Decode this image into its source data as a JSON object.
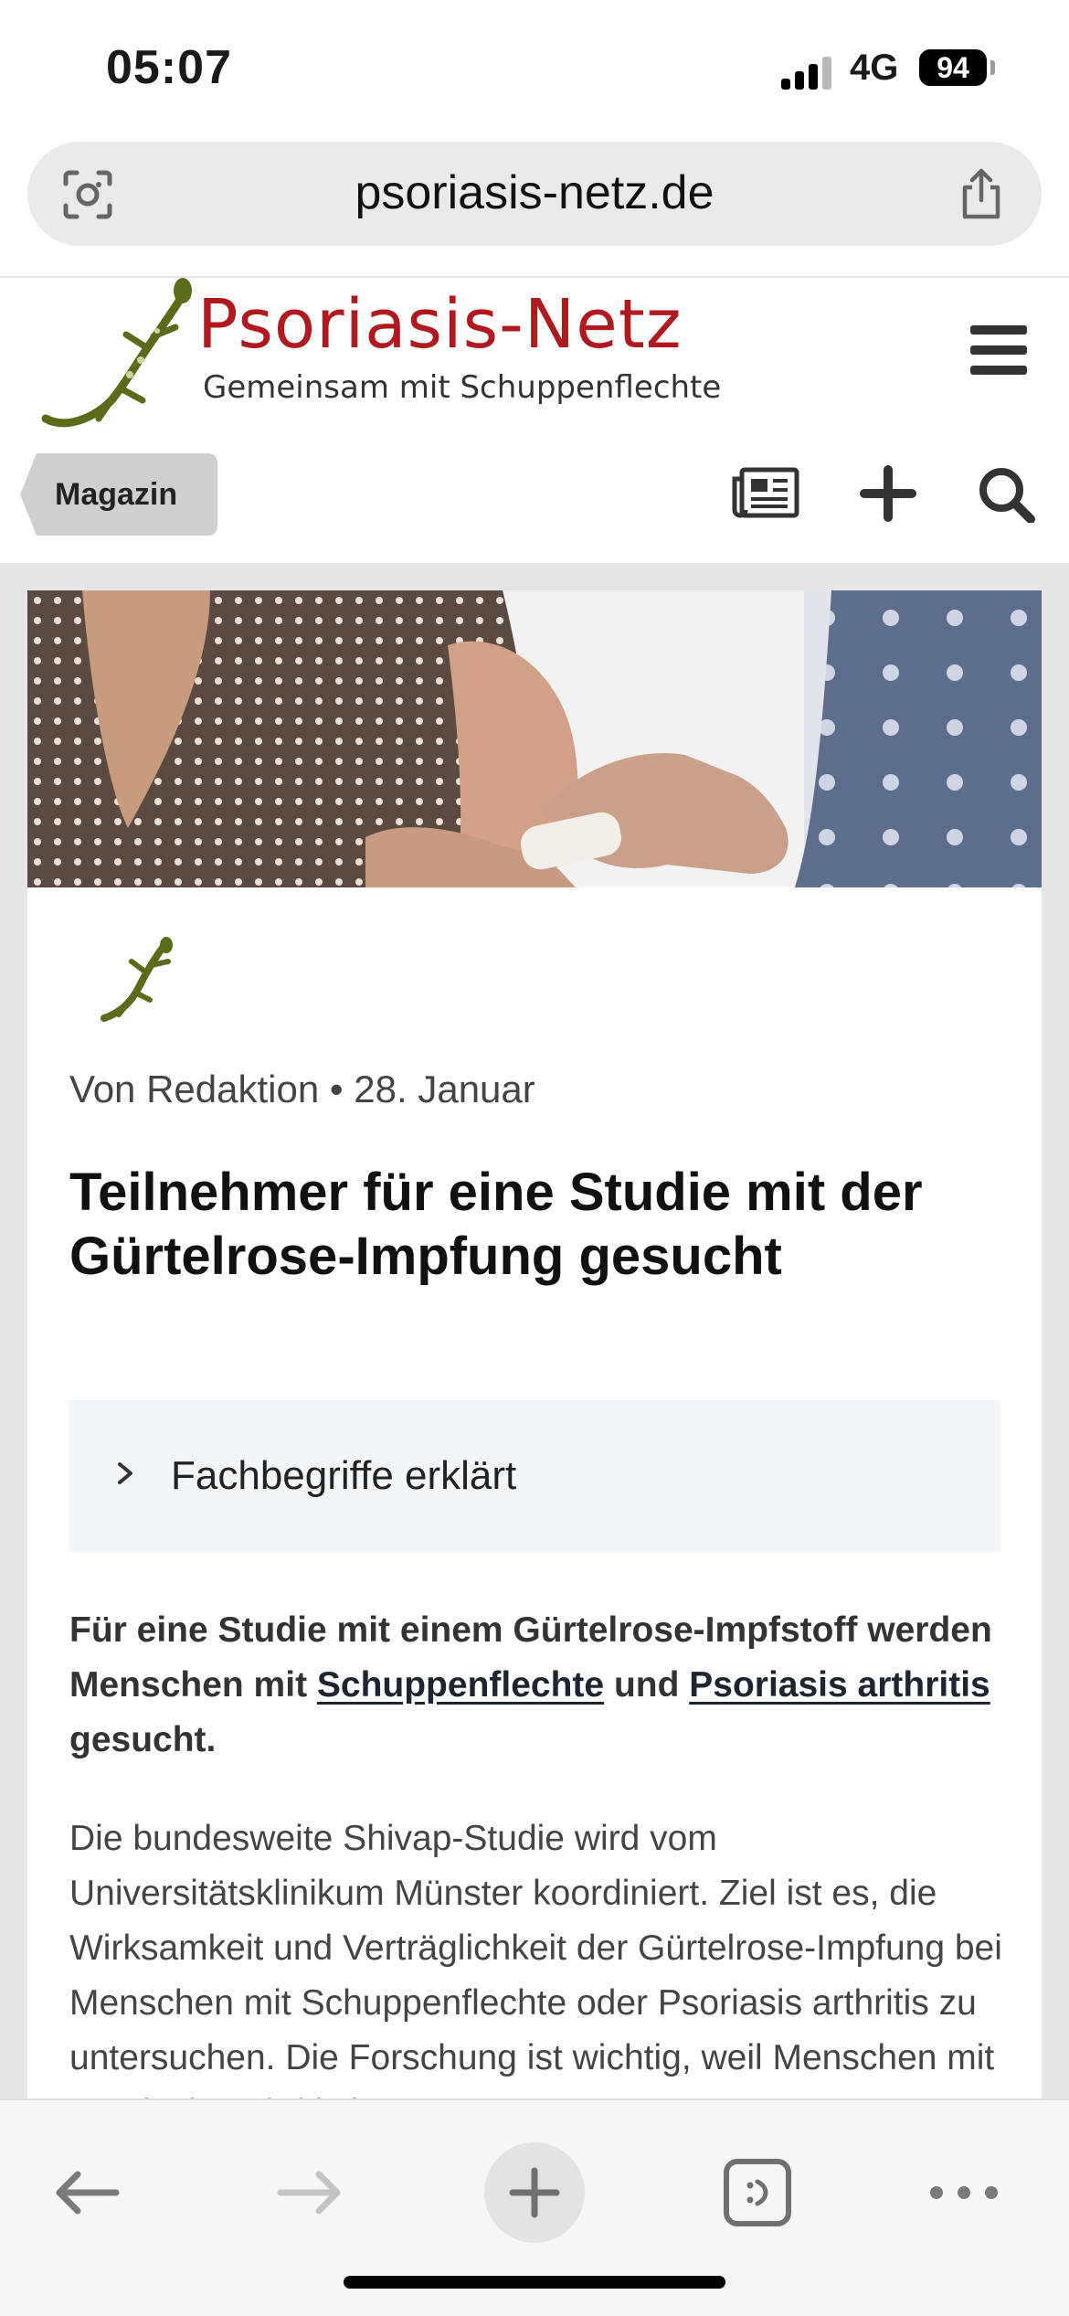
{
  "status_bar": {
    "time": "05:07",
    "network": "4G",
    "battery": "94"
  },
  "browser": {
    "url": "psoriasis-netz.de"
  },
  "site": {
    "title": "Psoriasis-Netz",
    "tagline": "Gemeinsam mit Schuppenflechte",
    "brand_color": "#b01a1f",
    "logo_color": "#5a6b1a",
    "section_tag": "Magazin"
  },
  "article": {
    "author": "Von Redaktion",
    "separator": "•",
    "date": "28. Januar",
    "title": "Teilnehmer für eine Studie mit der Gürtelrose-Impfung gesucht",
    "glossary_label": "Fachbegriffe erklärt",
    "lead": {
      "part1": "Für eine Studie mit einem Gürtelrose-Impfstoff werden Menschen mit ",
      "link1": "Schuppenflechte",
      "part2": " und ",
      "link2": "Psoriasis arthritis",
      "part3": " gesucht."
    },
    "body": "Die bundesweite Shivap-Studie wird vom Universitätsklinikum Münster koordiniert. Ziel ist es, die Wirksamkeit und Verträglichkeit der Gürtelrose-Impfung bei Menschen mit Schuppenflechte oder Psoriasis arthritis zu untersuchen. Die Forschung ist wichtig, weil Menschen mit Psoriasis arthritis in"
  },
  "icons": {
    "address_left": "lens-icon",
    "address_right": "share-icon",
    "menu": "hamburger-icon",
    "nav": [
      "newspaper-icon",
      "plus-icon",
      "search-icon"
    ],
    "toolbar": [
      "back-icon",
      "forward-icon",
      "new-tab-icon",
      "tabs-icon",
      "more-icon"
    ]
  }
}
